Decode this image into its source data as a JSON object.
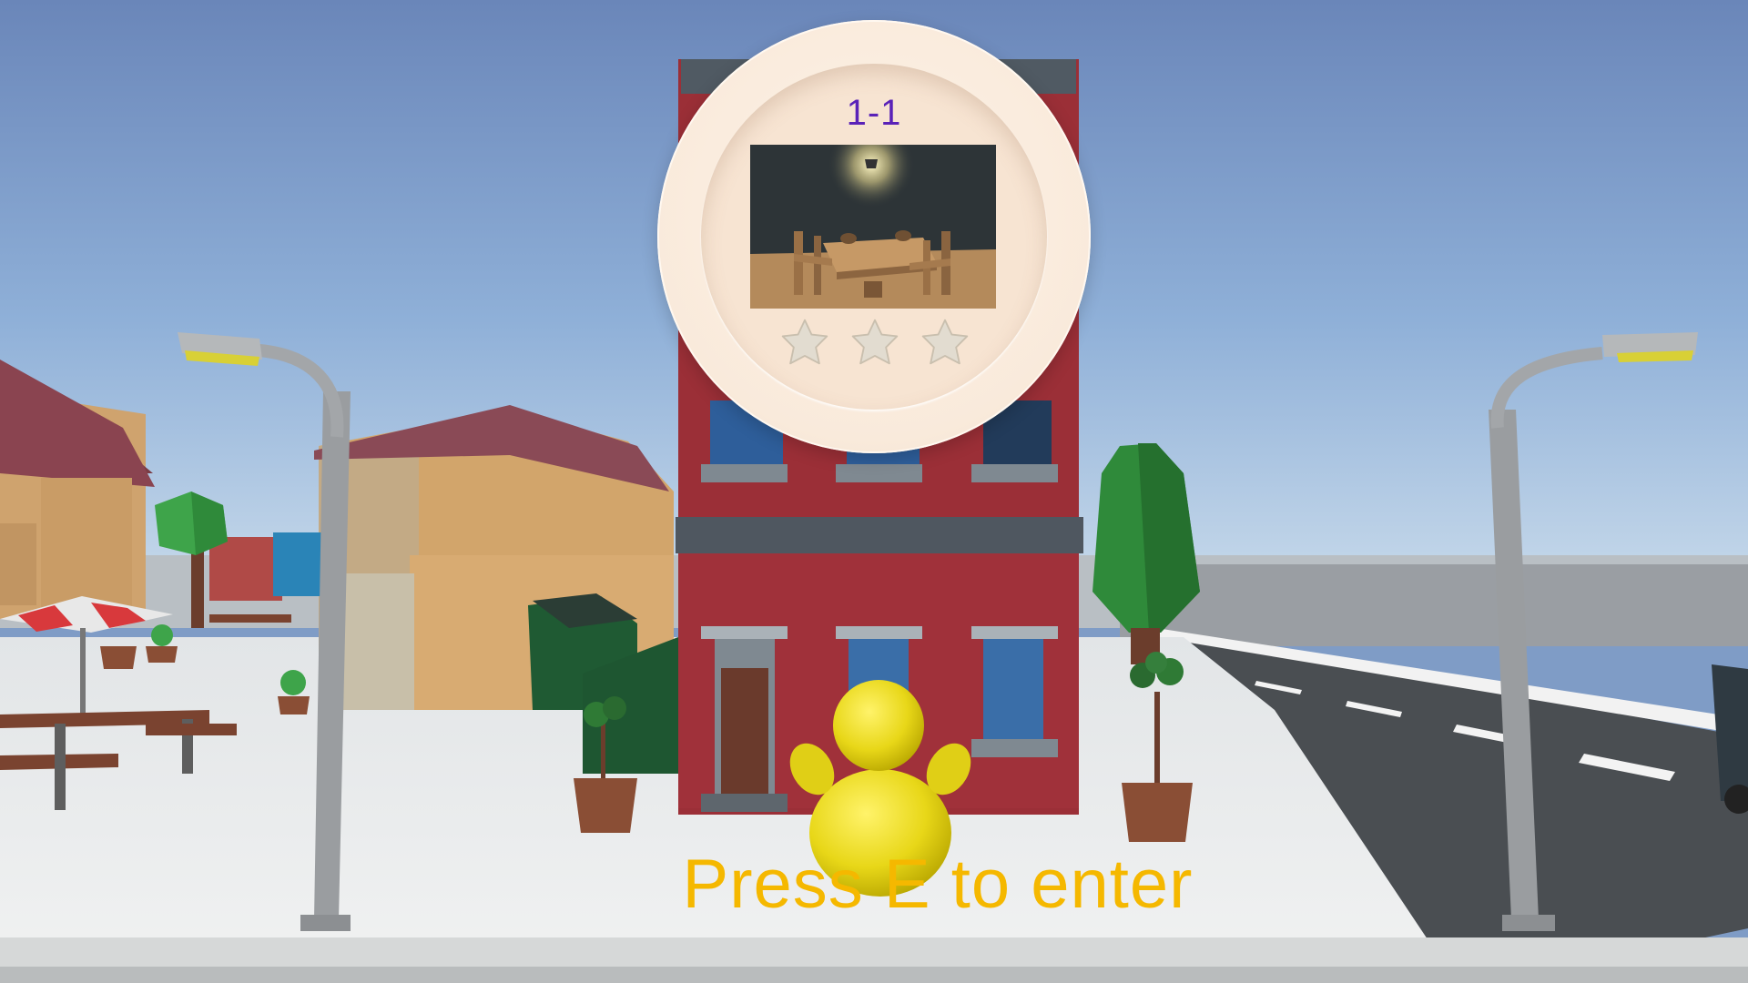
{
  "level": {
    "name": "1-1",
    "stars_earned": 0,
    "stars_total": 3
  },
  "prompt": {
    "text": "Press E to enter"
  },
  "colors": {
    "level_title": "#5a22b8",
    "prompt": "#f5b800",
    "card": "#f9eadb",
    "star_empty": "#e2dcd0"
  },
  "icons": [
    "star-icon",
    "star-icon",
    "star-icon"
  ]
}
